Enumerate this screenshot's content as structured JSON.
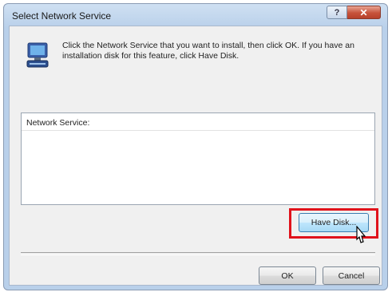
{
  "window": {
    "title": "Select Network Service",
    "help_glyph": "?",
    "close_glyph": "✕"
  },
  "description": "Click the Network Service that you want to install, then click OK. If you have an installation disk for this feature, click Have Disk.",
  "list": {
    "header": "Network Service:",
    "items": []
  },
  "buttons": {
    "have_disk": "Have Disk...",
    "ok": "OK",
    "cancel": "Cancel"
  },
  "colors": {
    "highlight": "#e0121b",
    "title_bar": "#b9d0ea",
    "dialog_face": "#f0f0f0"
  },
  "icons": {
    "dialog": "network-computer-icon",
    "pointer": "mouse-cursor-icon"
  }
}
